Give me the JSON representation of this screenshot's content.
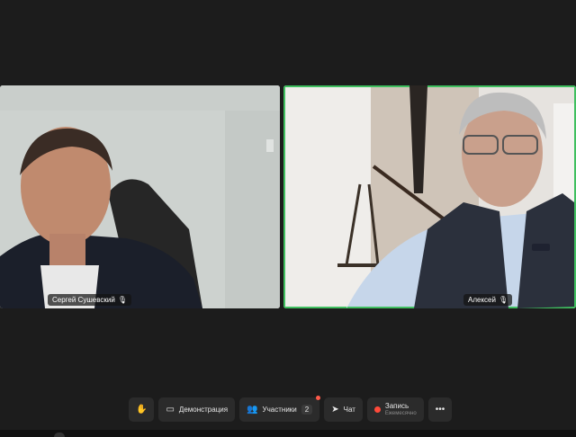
{
  "participants": [
    {
      "name": "Сергей Сушевский"
    },
    {
      "name": "Алексей"
    }
  ],
  "toolbar": {
    "raise_hand_icon": "hand-icon",
    "screen_share": {
      "label": "Демонстрация",
      "icon": "monitor-icon"
    },
    "participants": {
      "label": "Участники",
      "count": "2",
      "icon": "people-icon"
    },
    "chat": {
      "label": "Чат",
      "icon": "send-icon"
    },
    "record": {
      "label": "Запись",
      "sublabel": "Ежемесячно"
    },
    "more_icon": "more-icon"
  },
  "colors": {
    "background": "#1c1c1c",
    "active_speaker_border": "#3fbf5f",
    "record_dot": "#ff4a3a",
    "alert_dot": "#ff5a4a"
  }
}
